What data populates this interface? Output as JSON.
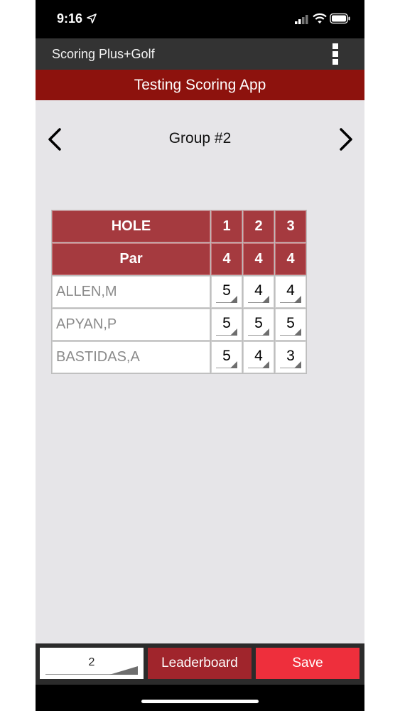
{
  "status": {
    "time": "9:16"
  },
  "app_bar": {
    "title": "Scoring Plus+Golf"
  },
  "banner": {
    "title": "Testing Scoring App"
  },
  "group_nav": {
    "title": "Group #2"
  },
  "scorecard": {
    "hole_label": "HOLE",
    "par_label": "Par",
    "holes": [
      "1",
      "2",
      "3"
    ],
    "pars": [
      "4",
      "4",
      "4"
    ],
    "players": [
      {
        "name": "ALLEN,M",
        "scores": [
          "5",
          "4",
          "4"
        ]
      },
      {
        "name": "APYAN,P",
        "scores": [
          "5",
          "5",
          "5"
        ]
      },
      {
        "name": "BASTIDAS,A",
        "scores": [
          "5",
          "4",
          "3"
        ]
      }
    ]
  },
  "bottom_bar": {
    "hole_select_value": "2",
    "leaderboard_label": "Leaderboard",
    "save_label": "Save"
  },
  "colors": {
    "banner": "#8d120d",
    "header_cell": "#a53a3f",
    "leaderboard": "#a0252c",
    "save": "#ee2f3c"
  }
}
